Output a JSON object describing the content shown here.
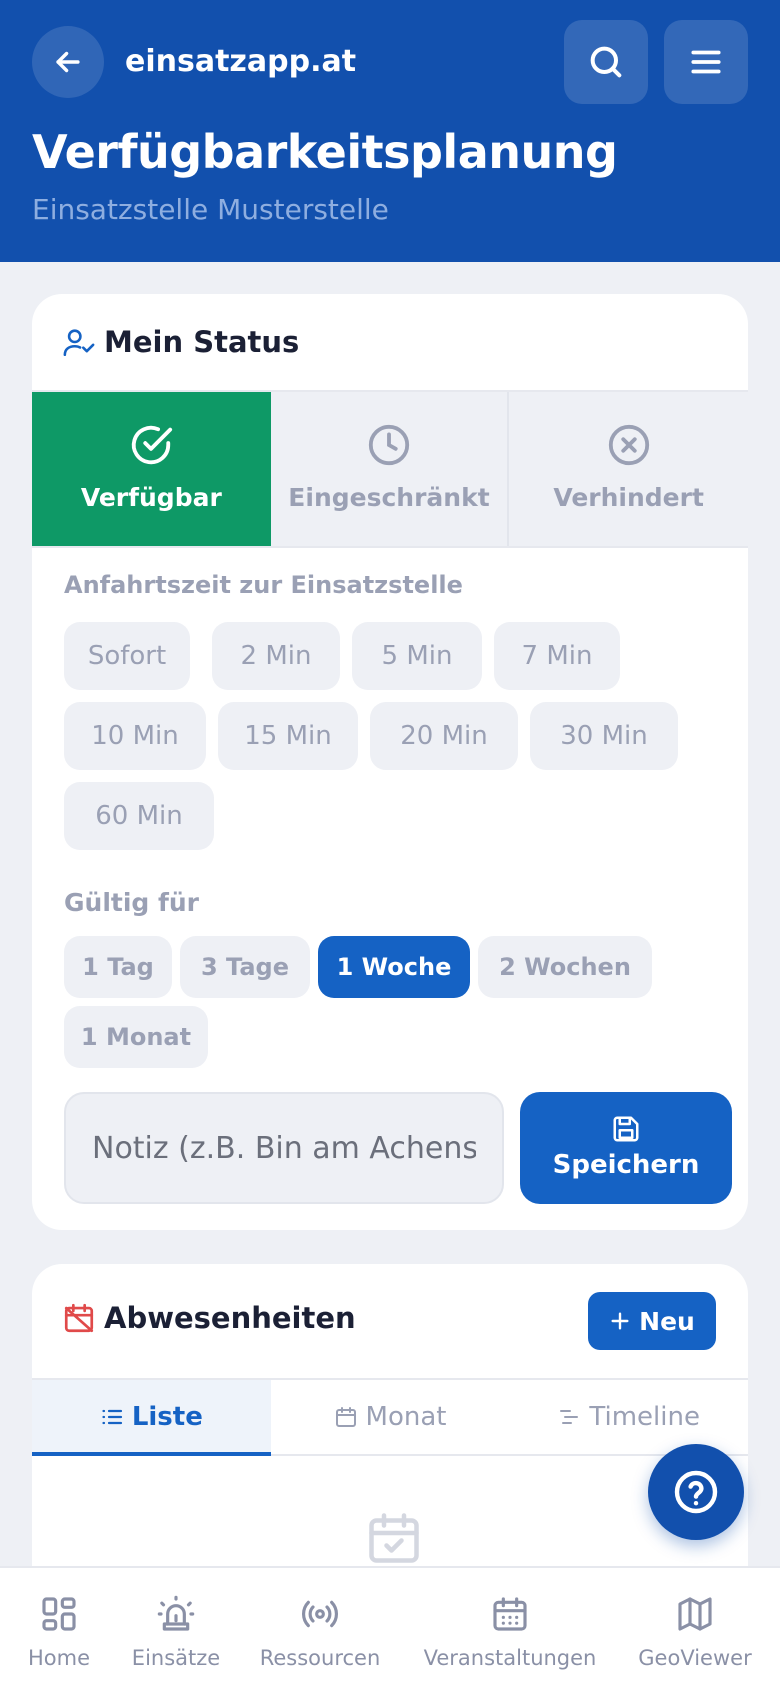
{
  "header": {
    "brand": "einsatzapp.at",
    "title": "Verfügbarkeitsplanung",
    "subtitle": "Einsatzstelle Musterstelle"
  },
  "status_card": {
    "title": "Mein Status",
    "options": [
      {
        "label": "Verfügbar",
        "icon": "check-circle-icon",
        "selected": true
      },
      {
        "label": "Eingeschränkt",
        "icon": "clock-icon",
        "selected": false
      },
      {
        "label": "Verhindert",
        "icon": "x-circle-icon",
        "selected": false
      }
    ],
    "travel_label": "Anfahrtszeit zur Einsatzstelle",
    "travel_times": [
      "Sofort",
      "2 Min",
      "5 Min",
      "7 Min",
      "10 Min",
      "15 Min",
      "20 Min",
      "30 Min",
      "60 Min"
    ],
    "validity_label": "Gültig für",
    "validity_options": [
      "1 Tag",
      "3 Tage",
      "1 Woche",
      "2 Wochen",
      "1 Monat"
    ],
    "validity_selected": "1 Woche",
    "note_placeholder": "Notiz (z.B. Bin am Achensee)",
    "save_label": "Speichern"
  },
  "absence_card": {
    "title": "Abwesenheiten",
    "new_label": "Neu",
    "tabs": [
      {
        "label": "Liste",
        "icon": "list-icon",
        "active": true
      },
      {
        "label": "Monat",
        "icon": "calendar-icon",
        "active": false
      },
      {
        "label": "Timeline",
        "icon": "timeline-icon",
        "active": false
      }
    ]
  },
  "bottom_nav": [
    {
      "label": "Home",
      "icon": "grid-icon"
    },
    {
      "label": "Einsätze",
      "icon": "siren-icon"
    },
    {
      "label": "Ressourcen",
      "icon": "broadcast-icon"
    },
    {
      "label": "Veranstaltungen",
      "icon": "calendar-icon"
    },
    {
      "label": "GeoViewer",
      "icon": "map-icon"
    }
  ],
  "colors": {
    "primary": "#1250ad",
    "accent": "#1562c4",
    "available": "#0e9966",
    "absence_icon": "#e04a4a"
  }
}
